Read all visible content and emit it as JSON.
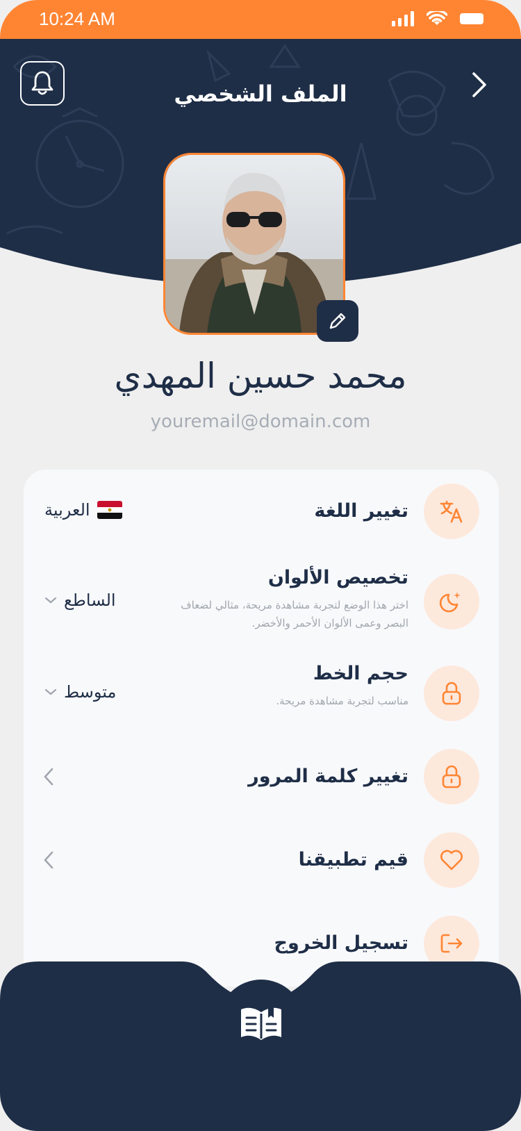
{
  "status_bar": {
    "time": "10:24 AM"
  },
  "header": {
    "title": "الملف الشخصي"
  },
  "profile": {
    "name": "محمد حسين المهدي",
    "email": "youremail@domain.com"
  },
  "settings": {
    "language": {
      "title": "تغيير اللغة",
      "value": "العربية",
      "icon": "translate-icon"
    },
    "colors": {
      "title": "تخصيص الألوان",
      "description": "اختر هذا الوضع لتجربة مشاهدة مريحة، مثالي لضعاف البصر وعمى الألوان الأحمر والأخضر.",
      "value": "الساطع",
      "icon": "moon-icon"
    },
    "font_size": {
      "title": "حجم الخط",
      "description": "مناسب لتجربة مشاهدة مريحة.",
      "value": "متوسط",
      "icon": "lock-icon"
    },
    "password": {
      "title": "تغيير كلمة المرور",
      "icon": "lock-icon"
    },
    "rate": {
      "title": "قيم تطبيقنا",
      "icon": "heart-icon"
    },
    "logout": {
      "title": "تسجيل الخروج",
      "icon": "logout-icon"
    }
  },
  "nav": {
    "items": [
      "home-icon",
      "calendar-icon",
      "book-icon",
      "report-icon",
      "profile-icon"
    ],
    "active": "profile-icon"
  },
  "colors": {
    "accent": "#ff8533",
    "navy": "#1f2e47",
    "icon_bg": "#fde8dc",
    "background": "#efefef"
  }
}
